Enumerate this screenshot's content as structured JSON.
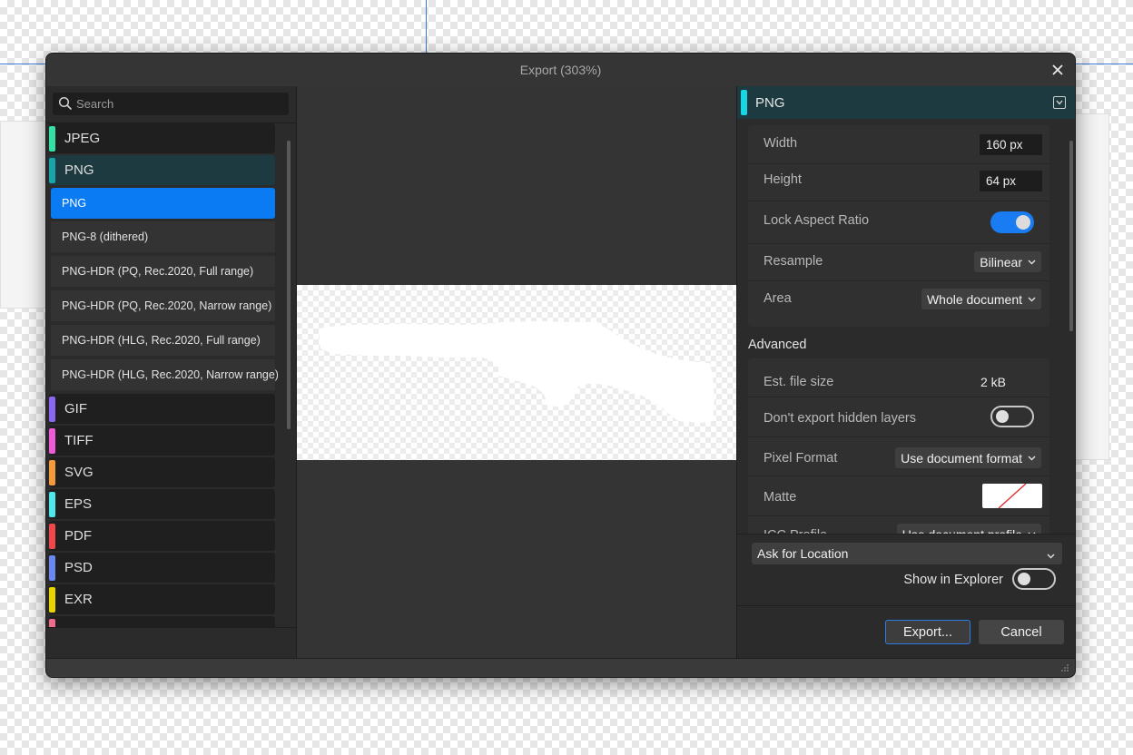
{
  "dialog": {
    "title": "Export (303%)"
  },
  "search": {
    "placeholder": "Search"
  },
  "formats": [
    {
      "label": "JPEG",
      "color": "#34e0a4"
    },
    {
      "label": "PNG",
      "color": "#1aa3a8"
    },
    {
      "label": "GIF",
      "color": "#8a67f0"
    },
    {
      "label": "TIFF",
      "color": "#ef5bd6"
    },
    {
      "label": "SVG",
      "color": "#f59a3a"
    },
    {
      "label": "EPS",
      "color": "#4fe8ea"
    },
    {
      "label": "PDF",
      "color": "#f0484a"
    },
    {
      "label": "PSD",
      "color": "#6a88f0"
    },
    {
      "label": "EXR",
      "color": "#e8d400"
    }
  ],
  "png_presets": [
    "PNG",
    "PNG-8 (dithered)",
    "PNG-HDR (PQ, Rec.2020, Full range)",
    "PNG-HDR (PQ, Rec.2020, Narrow range)",
    "PNG-HDR (HLG, Rec.2020, Full range)",
    "PNG-HDR (HLG, Rec.2020, Narrow range)"
  ],
  "selected_preset": "PNG",
  "settings": {
    "format_name": "PNG",
    "width_label": "Width",
    "width_value": "160 px",
    "height_label": "Height",
    "height_value": "64 px",
    "lock_label": "Lock Aspect Ratio",
    "lock_on": true,
    "resample_label": "Resample",
    "resample_value": "Bilinear",
    "area_label": "Area",
    "area_value": "Whole document"
  },
  "advanced": {
    "title": "Advanced",
    "file_size_label": "Est. file size",
    "file_size_value": "2 kB",
    "hidden_layers_label": "Don't export hidden layers",
    "hidden_layers_on": false,
    "pixel_format_label": "Pixel Format",
    "pixel_format_value": "Use document format",
    "matte_label": "Matte",
    "icc_label": "ICC Profile",
    "icc_value": "Use document profile"
  },
  "location": {
    "value": "Ask for Location",
    "show_explorer_label": "Show in Explorer",
    "show_explorer_on": false
  },
  "buttons": {
    "export": "Export...",
    "cancel": "Cancel"
  },
  "colors": {
    "accent": "#0a7bf2",
    "active_format_bg": "#1d3a40",
    "png_accent": "#18d6e4"
  }
}
